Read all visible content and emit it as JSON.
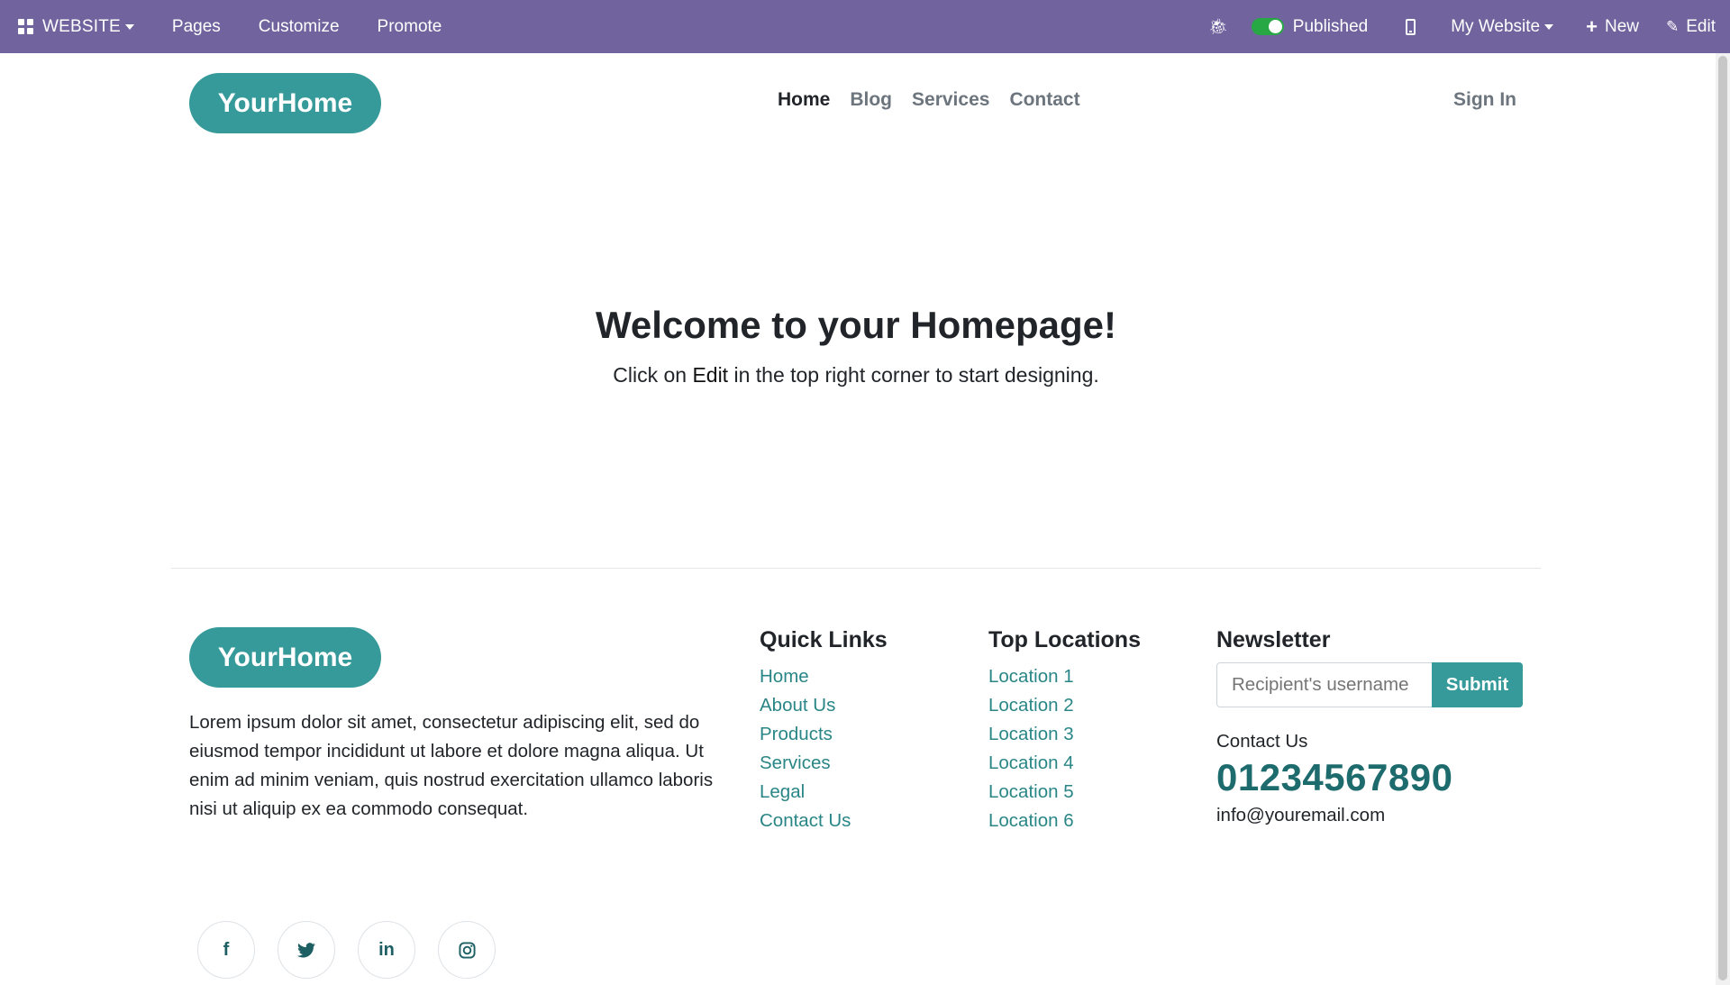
{
  "adminbar": {
    "brand": "WEBSITE",
    "menu": [
      "Pages",
      "Customize",
      "Promote"
    ],
    "published_label": "Published",
    "site_label": "My Website",
    "new_label": "New",
    "edit_label": "Edit",
    "color": "#71639e"
  },
  "header": {
    "logo": "YourHome",
    "nav": [
      "Home",
      "Blog",
      "Services",
      "Contact"
    ],
    "signin": "Sign In"
  },
  "hero": {
    "title": "Welcome to your Homepage!",
    "subtitle_before": "Click on ",
    "subtitle_bold": "Edit",
    "subtitle_after": " in the top right corner to start designing."
  },
  "footer": {
    "logo": "YourHome",
    "about": "Lorem ipsum dolor sit amet, consectetur adipiscing elit, sed do eiusmod tempor incididunt ut labore et dolore magna aliqua. Ut enim ad minim veniam, quis nostrud exercitation ullamco laboris nisi ut aliquip ex ea commodo consequat.",
    "quick_links": {
      "title": "Quick Links",
      "items": [
        "Home",
        "About Us",
        "Products",
        "Services",
        "Legal",
        "Contact Us"
      ]
    },
    "top_locations": {
      "title": "Top Locations",
      "items": [
        "Location 1",
        "Location 2",
        "Location 3",
        "Location 4",
        "Location 5",
        "Location 6"
      ]
    },
    "newsletter": {
      "title": "Newsletter",
      "placeholder": "Recipient's username",
      "submit": "Submit",
      "contact_label": "Contact Us",
      "phone": "01234567890",
      "email": "info@youremail.com"
    },
    "socials": [
      "facebook-icon",
      "twitter-icon",
      "linkedin-icon",
      "instagram-icon"
    ]
  },
  "colors": {
    "accent": "#36999a",
    "link": "#2a8686",
    "phone": "#1e6b6e"
  }
}
